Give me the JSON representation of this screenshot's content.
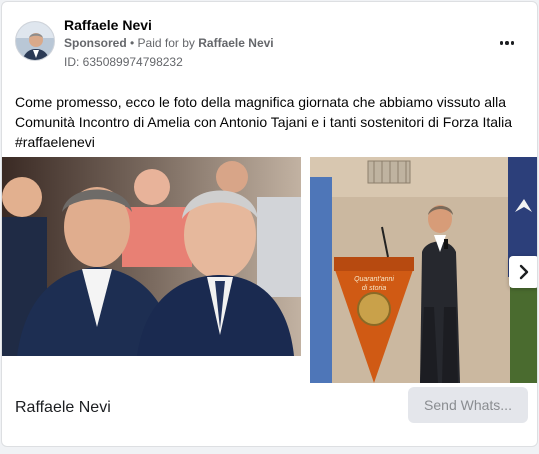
{
  "ad": {
    "author_name": "Raffaele Nevi",
    "sponsored_label": "Sponsored",
    "separator": " • ",
    "paid_for_prefix": "Paid for by ",
    "paid_for_by": "Raffaele Nevi",
    "ad_id": "ID: 635089974798232",
    "more_icon": "more-horizontal-icon"
  },
  "post": {
    "text_main": "Come promesso, ecco le foto della magnifica giornata che abbiamo vissuto alla Comunità Incontro di Amelia con Antonio Tajani e i tanti sostenitori di Forza Italia",
    "hashtag": "#raffaelenevi"
  },
  "carousel": {
    "next_icon": "chevron-right-icon",
    "podium_text_top": "Quarant'anni",
    "podium_text_bottom": "di storia"
  },
  "footer": {
    "page_name": "Raffaele Nevi",
    "cta_label": "Send Whats..."
  },
  "colors": {
    "name_text": "#050505",
    "meta_text": "#65676b",
    "card_border": "#dddfe2",
    "cta_bg": "#e4e6eb",
    "cta_text": "#8a8d91",
    "podium": "#d05a14"
  }
}
